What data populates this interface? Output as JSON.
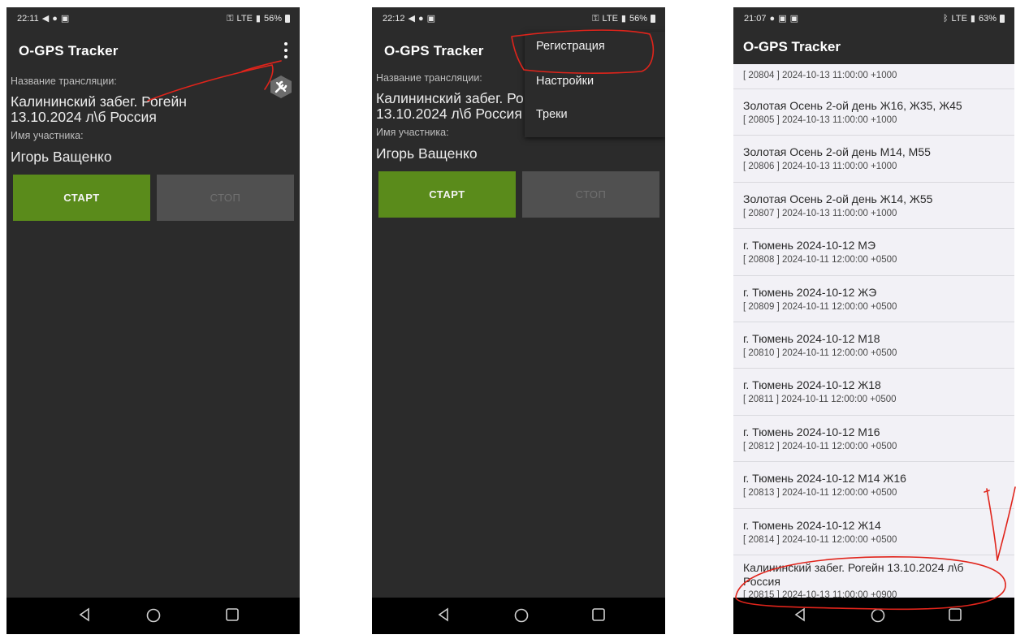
{
  "screens": [
    {
      "status": {
        "time": "22:11",
        "signal": "LTE",
        "battery": "56%"
      },
      "app_title": "O-GPS Tracker",
      "broadcast_label": "Название трансляции:",
      "broadcast_line1": "Калининский забег. Рогейн",
      "broadcast_line2": "13.10.2024  л\\б Россия",
      "participant_label": "Имя участника:",
      "participant_name": "Игорь Ващенко",
      "start_label": "СТАРТ",
      "stop_label": "СТОП"
    },
    {
      "status": {
        "time": "22:12",
        "signal": "LTE",
        "battery": "56%"
      },
      "app_title": "O-GPS Tracker",
      "broadcast_label": "Название трансляции:",
      "broadcast_line1": "Калининский забег. Ро",
      "broadcast_line2": "13.10.2024  л\\б Россия",
      "participant_label": "Имя участника:",
      "participant_name": "Игорь Ващенко",
      "start_label": "СТАРТ",
      "stop_label": "СТОП",
      "menu": [
        "Регистрация",
        "Настройки",
        "Треки"
      ]
    },
    {
      "status": {
        "time": "21:07",
        "signal": "LTE",
        "battery": "63%"
      },
      "app_title": "O-GPS Tracker",
      "partial_top": "[ 20804 ] 2024-10-13 11:00:00 +1000",
      "items": [
        {
          "name": "Золотая Осень 2-ой день Ж16, Ж35, Ж45",
          "meta": "[ 20805 ] 2024-10-13 11:00:00 +1000"
        },
        {
          "name": "Золотая Осень 2-ой день М14, М55",
          "meta": "[ 20806 ] 2024-10-13 11:00:00 +1000"
        },
        {
          "name": "Золотая Осень 2-ой день Ж14, Ж55",
          "meta": "[ 20807 ] 2024-10-13 11:00:00 +1000"
        },
        {
          "name": "г. Тюмень 2024-10-12 МЭ",
          "meta": "[ 20808 ] 2024-10-11 12:00:00 +0500"
        },
        {
          "name": "г. Тюмень 2024-10-12 ЖЭ",
          "meta": "[ 20809 ] 2024-10-11 12:00:00 +0500"
        },
        {
          "name": "г. Тюмень 2024-10-12 М18",
          "meta": "[ 20810 ] 2024-10-11 12:00:00 +0500"
        },
        {
          "name": "г. Тюмень 2024-10-12 Ж18",
          "meta": "[ 20811 ] 2024-10-11 12:00:00 +0500"
        },
        {
          "name": "г. Тюмень 2024-10-12 М16",
          "meta": "[ 20812 ] 2024-10-11 12:00:00 +0500"
        },
        {
          "name": "г. Тюмень 2024-10-12 М14 Ж16",
          "meta": "[ 20813 ] 2024-10-11 12:00:00 +0500"
        },
        {
          "name": "г. Тюмень 2024-10-12 Ж14",
          "meta": "[ 20814 ] 2024-10-11 12:00:00 +0500"
        }
      ],
      "last_item": {
        "line1": "Калининский забег. Рогейн 13.10.2024  л\\б",
        "line2": "Россия",
        "meta": "[ 20815 ] 2024-10-13 11:00:00 +0900"
      }
    }
  ],
  "colors": {
    "start": "#5a8b1b",
    "stop": "#505050",
    "annotation": "#e0241b"
  },
  "icons": [
    "telegram-icon",
    "location-icon",
    "youtube-icon",
    "key-icon",
    "bluetooth-icon",
    "battery-icon",
    "more-vert-icon",
    "wrench-icon",
    "back-icon",
    "home-icon",
    "recents-icon"
  ]
}
